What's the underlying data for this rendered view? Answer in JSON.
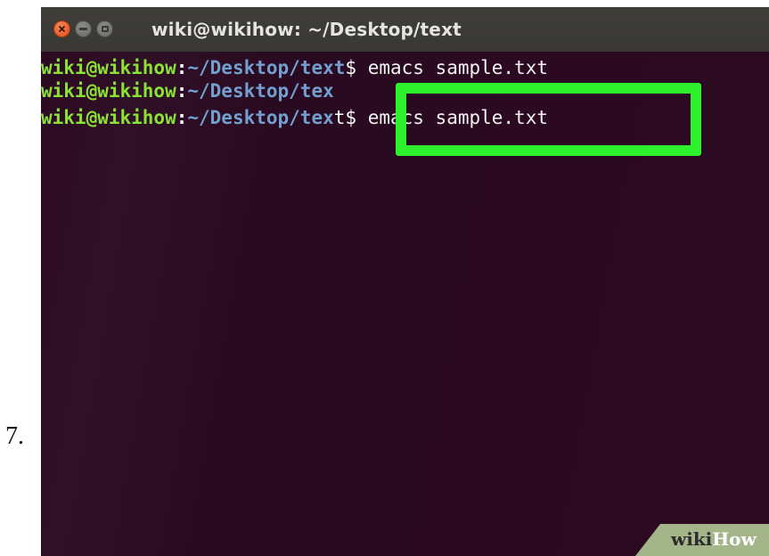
{
  "step": {
    "number": "7."
  },
  "window": {
    "title": "wiki@wikihow: ~/Desktop/text"
  },
  "terminal": {
    "lines": [
      {
        "user": "wiki@wikihow",
        "colon": ":",
        "path": "~/Desktop/text",
        "symbol": "$",
        "command": " emacs sample.txt"
      },
      {
        "user": "wiki@wikihow",
        "colon": ":",
        "path": "~/Desktop/tex",
        "symbol": "",
        "command": ""
      },
      {
        "user": "wiki@wikihow",
        "colon": ":",
        "path": "~/Desktop/tex",
        "symbol": "t$",
        "command": " emacs sample.txt"
      }
    ]
  },
  "colors": {
    "terminal_bg": "#2c0a22",
    "prompt_user": "#8ae234",
    "prompt_path": "#729fcf",
    "highlight": "#2ef12e"
  },
  "watermark": {
    "part1": "wiki",
    "part2": "How"
  }
}
